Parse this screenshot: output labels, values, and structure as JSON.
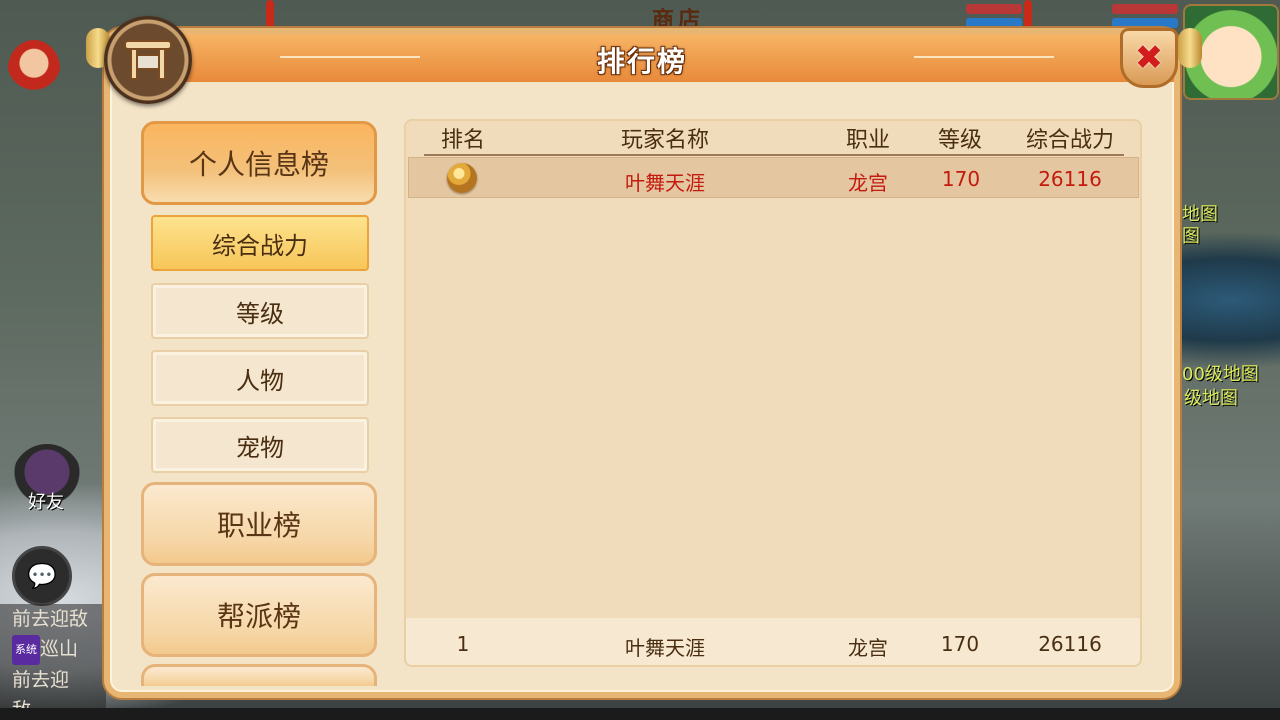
{
  "background": {
    "shop_sign": "商店",
    "friends_label": "好友",
    "right_labels": [
      "地图",
      "图",
      "00级地图",
      "级地图"
    ],
    "chat_lines": [
      "前去迎敌",
      "巡山",
      "前去迎敌。"
    ],
    "chat_system_tag": "系统"
  },
  "window": {
    "title": "排行榜"
  },
  "menu": {
    "categories": [
      {
        "label": "个人信息榜",
        "active": true
      },
      {
        "label": "职业榜",
        "active": false
      },
      {
        "label": "帮派榜",
        "active": false
      }
    ],
    "subitems": [
      {
        "label": "综合战力",
        "active": true
      },
      {
        "label": "等级",
        "active": false
      },
      {
        "label": "人物",
        "active": false
      },
      {
        "label": "宠物",
        "active": false
      }
    ]
  },
  "table": {
    "columns": [
      "排名",
      "玩家名称",
      "职业",
      "等级",
      "综合战力"
    ],
    "rows": [
      {
        "rank": "1",
        "rank_icon": "gold-medal-icon",
        "name": "叶舞天涯",
        "class": "龙宫",
        "level": "170",
        "power": "26116"
      }
    ],
    "my_rank": {
      "rank": "1",
      "name": "叶舞天涯",
      "class": "龙宫",
      "level": "170",
      "power": "26116"
    }
  },
  "colors": {
    "title_bar": "#e8893a",
    "highlight_text": "#c41a10",
    "normal_text": "#4a2e12",
    "panel_bg": "#f3e3c7"
  }
}
